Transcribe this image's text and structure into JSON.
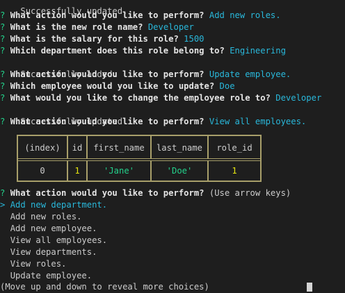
{
  "history": [
    {
      "type": "status",
      "text": "Successfully updated."
    },
    {
      "type": "qa",
      "q": "What action would you like to perform?",
      "a": "Add new roles."
    },
    {
      "type": "qa",
      "q": "What is the new role name?",
      "a": "Developer"
    },
    {
      "type": "qa",
      "q": "What is the salary for this role?",
      "a": "1500"
    },
    {
      "type": "qa",
      "q": "Which department does this role belong to?",
      "a": "Engineering"
    },
    {
      "type": "status",
      "text": "Successfully added."
    },
    {
      "type": "qa",
      "q": "What action would you like to perform?",
      "a": "Update employee."
    },
    {
      "type": "qa",
      "q": "Which employee would you like to update?",
      "a": "Doe"
    },
    {
      "type": "qa",
      "q": "What would you like to change the employee role to?",
      "a": "Developer"
    },
    {
      "type": "status",
      "text": "Successfully updated."
    },
    {
      "type": "qa",
      "q": "What action would you like to perform?",
      "a": "View all employees."
    }
  ],
  "prompt_mark": "?",
  "table": {
    "headers": [
      "(index)",
      "id",
      "first_name",
      "last_name",
      "role_id"
    ],
    "rows": [
      [
        "0",
        "1",
        "'Jane'",
        "'Doe'",
        "1"
      ]
    ]
  },
  "current_prompt": {
    "question": "What action would you like to perform?",
    "hint": "(Use arrow keys)"
  },
  "menu": {
    "pointer": ">",
    "selected_index": 0,
    "options": [
      "Add new department.",
      "Add new roles.",
      "Add new employee.",
      "View all employees.",
      "View departments.",
      "View roles.",
      "Update employee."
    ]
  },
  "footer_hint": "(Move up and down to reveal more choices)",
  "colors": {
    "prompt_mark": "#23d18b",
    "answer": "#29b8db",
    "number": "#e5e510",
    "string": "#23d18b",
    "table_border": "#a89f6a"
  }
}
